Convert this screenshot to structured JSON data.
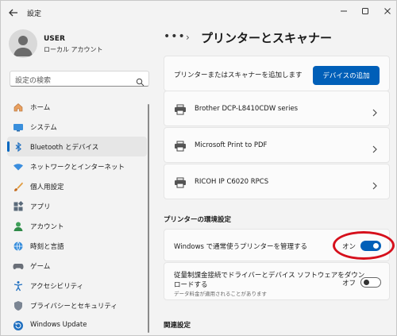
{
  "app": {
    "title": "設定",
    "controls": {
      "minimize": "minimize",
      "maximize": "maximize",
      "close": "close"
    }
  },
  "user": {
    "name": "USER",
    "account_type": "ローカル アカウント"
  },
  "search": {
    "placeholder": "設定の検索"
  },
  "sidebar": {
    "items": [
      {
        "label": "ホーム",
        "icon": "home-icon",
        "selected": false
      },
      {
        "label": "システム",
        "icon": "system-icon",
        "selected": false
      },
      {
        "label": "Bluetooth とデバイス",
        "icon": "bluetooth-icon",
        "selected": true
      },
      {
        "label": "ネットワークとインターネット",
        "icon": "wifi-icon",
        "selected": false
      },
      {
        "label": "個人用設定",
        "icon": "brush-icon",
        "selected": false
      },
      {
        "label": "アプリ",
        "icon": "apps-icon",
        "selected": false
      },
      {
        "label": "アカウント",
        "icon": "account-icon",
        "selected": false
      },
      {
        "label": "時刻と言語",
        "icon": "globe-icon",
        "selected": false
      },
      {
        "label": "ゲーム",
        "icon": "gamepad-icon",
        "selected": false
      },
      {
        "label": "アクセシビリティ",
        "icon": "accessibility-icon",
        "selected": false
      },
      {
        "label": "プライバシーとセキュリティ",
        "icon": "shield-icon",
        "selected": false
      },
      {
        "label": "Windows Update",
        "icon": "update-icon",
        "selected": false
      }
    ]
  },
  "breadcrumb": {
    "more": "•••",
    "separator": "›",
    "title": "プリンターとスキャナー"
  },
  "add_printer": {
    "text": "プリンターまたはスキャナーを追加します",
    "button": "デバイスの追加"
  },
  "printers": [
    {
      "name": "Brother DCP-L8410CDW series"
    },
    {
      "name": "Microsoft Print to PDF"
    },
    {
      "name": "RICOH IP C6020 RPCS"
    }
  ],
  "preferences": {
    "title": "プリンターの環境設定",
    "manage_default": {
      "label": "Windows で通常使うプリンターを管理する",
      "state_label": "オン",
      "on": true
    },
    "metered": {
      "label_line1": "従量制課金接続でドライバーとデバイス ソフトウェアをダウン",
      "label_line2": "ロードする",
      "subtext": "データ料金が適用されることがあります",
      "state_label": "オフ",
      "on": false
    }
  },
  "related": {
    "title": "関連設定"
  },
  "colors": {
    "accent": "#005fb8",
    "highlight": "#d6101c"
  }
}
